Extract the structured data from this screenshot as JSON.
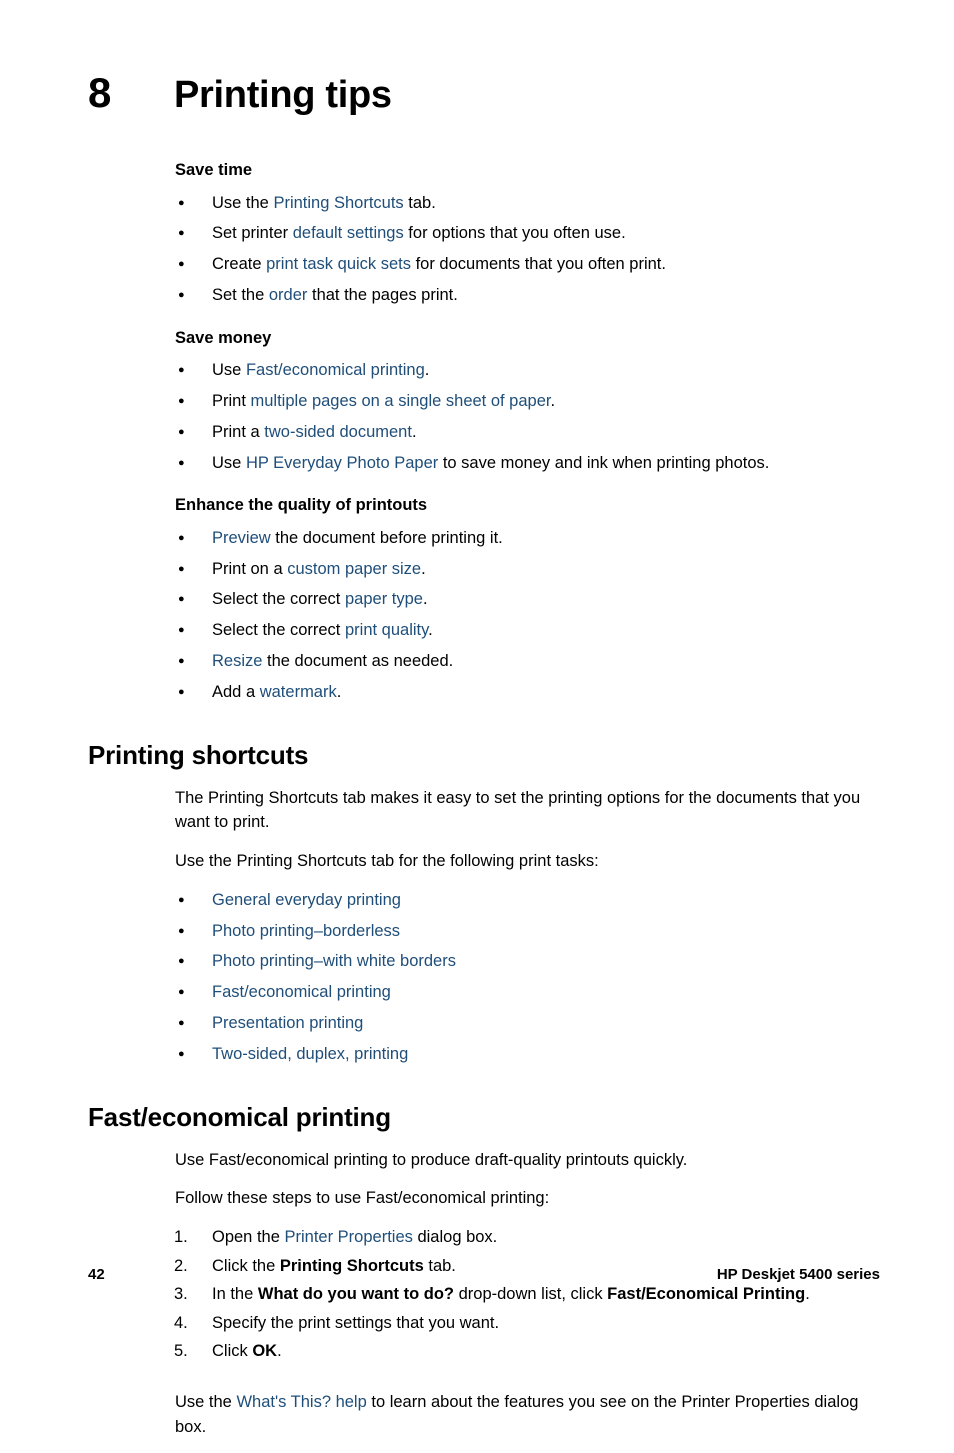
{
  "chapter": {
    "number": "8",
    "title": "Printing tips"
  },
  "save_time": {
    "heading": "Save time",
    "items": [
      {
        "pre": "Use the ",
        "link": "Printing Shortcuts",
        "post": " tab."
      },
      {
        "pre": "Set printer ",
        "link": "default settings",
        "post": " for options that you often use."
      },
      {
        "pre": "Create ",
        "link": "print task quick sets",
        "post": " for documents that you often print."
      },
      {
        "pre": "Set the ",
        "link": "order",
        "post": " that the pages print."
      }
    ]
  },
  "save_money": {
    "heading": "Save money",
    "items": [
      {
        "pre": "Use ",
        "link": "Fast/economical printing",
        "post": "."
      },
      {
        "pre": "Print ",
        "link": "multiple pages on a single sheet of paper",
        "post": "."
      },
      {
        "pre": "Print a ",
        "link": "two-sided document",
        "post": "."
      },
      {
        "pre": "Use ",
        "link": "HP Everyday Photo Paper",
        "post": " to save money and ink when printing photos."
      }
    ]
  },
  "enhance_quality": {
    "heading": "Enhance the quality of printouts",
    "items": [
      {
        "pre": "",
        "link": "Preview",
        "post": " the document before printing it."
      },
      {
        "pre": "Print on a ",
        "link": "custom paper size",
        "post": "."
      },
      {
        "pre": "Select the correct ",
        "link": "paper type",
        "post": "."
      },
      {
        "pre": "Select the correct ",
        "link": "print quality",
        "post": "."
      },
      {
        "pre": "",
        "link": "Resize",
        "post": " the document as needed."
      },
      {
        "pre": "Add a ",
        "link": "watermark",
        "post": "."
      }
    ]
  },
  "printing_shortcuts": {
    "heading": "Printing shortcuts",
    "paragraph_1": "The Printing Shortcuts tab makes it easy to set the printing options for the documents that you want to print.",
    "paragraph_2": "Use the Printing Shortcuts tab for the following print tasks:",
    "links": [
      "General everyday printing",
      "Photo printing–borderless",
      "Photo printing–with white borders",
      "Fast/economical printing",
      "Presentation printing",
      "Two-sided, duplex, printing"
    ]
  },
  "fast_economical": {
    "heading": "Fast/economical printing",
    "paragraph_1": "Use Fast/economical printing to produce draft-quality printouts quickly.",
    "paragraph_2": "Follow these steps to use Fast/economical printing:",
    "steps": [
      {
        "num": "1.",
        "parts": [
          {
            "t": "Open the ",
            "s": "plain"
          },
          {
            "t": "Printer Properties",
            "s": "link"
          },
          {
            "t": " dialog box.",
            "s": "plain"
          }
        ]
      },
      {
        "num": "2.",
        "parts": [
          {
            "t": "Click the ",
            "s": "plain"
          },
          {
            "t": "Printing Shortcuts",
            "s": "bold"
          },
          {
            "t": " tab.",
            "s": "plain"
          }
        ]
      },
      {
        "num": "3.",
        "parts": [
          {
            "t": "In the ",
            "s": "plain"
          },
          {
            "t": "What do you want to do?",
            "s": "bold"
          },
          {
            "t": " drop-down list, click ",
            "s": "plain"
          },
          {
            "t": "Fast/Economical Printing",
            "s": "bold"
          },
          {
            "t": ".",
            "s": "plain"
          }
        ]
      },
      {
        "num": "4.",
        "parts": [
          {
            "t": "Specify the print settings that you want.",
            "s": "plain"
          }
        ]
      },
      {
        "num": "5.",
        "parts": [
          {
            "t": "Click ",
            "s": "plain"
          },
          {
            "t": "OK",
            "s": "bold"
          },
          {
            "t": ".",
            "s": "plain"
          }
        ]
      }
    ],
    "closing": {
      "pre": "Use the ",
      "link": "What's This? help",
      "post": " to learn about the features you see on the Printer Properties dialog box."
    }
  },
  "footer": {
    "page_number": "42",
    "product": "HP Deskjet 5400 series"
  },
  "colors": {
    "link": "#1F4E79",
    "text": "#000000",
    "background": "#FFFFFF"
  }
}
